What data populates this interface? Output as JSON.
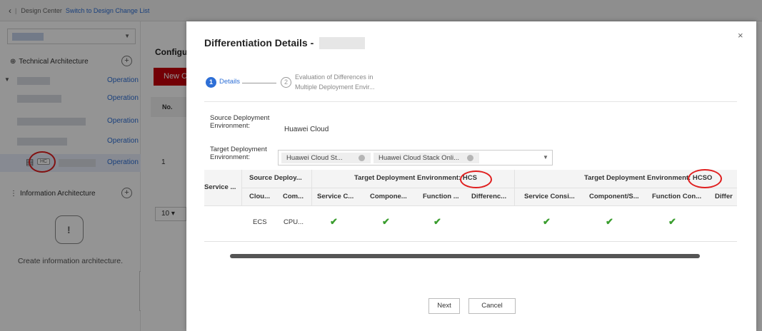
{
  "topbar": {
    "back_icon": "‹",
    "separator": "|",
    "title": "Design Center",
    "link": "Switch to Design Change List"
  },
  "sidebar": {
    "technical_architecture": "Technical Architecture",
    "information_architecture": "Information Architecture",
    "operation_label": "Operation",
    "hc_tag": "HC",
    "empty_text": "Create information architecture.",
    "collapse_icon": "‹"
  },
  "main": {
    "config_title": "Configu",
    "new_button": "New C",
    "table_header_no": "No.",
    "row_no": "1",
    "page_size": "10"
  },
  "modal": {
    "title": "Differentiation Details -",
    "close_icon": "×",
    "steps": [
      {
        "number": "1",
        "label": "Details"
      },
      {
        "number": "2",
        "label_line1": "Evaluation of Differences in",
        "label_line2": "Multiple Deployment Envir..."
      }
    ],
    "source_env_label_line1": "Source Deployment",
    "source_env_label_line2": "Environment:",
    "source_env_value": "Huawei Cloud",
    "target_env_label_line1": "Target Deployment",
    "target_env_label_line2": "Environment:",
    "target_chips": [
      "Huawei Cloud St...",
      "Huawei Cloud Stack Onli..."
    ],
    "table": {
      "col_service": "Service ...",
      "source_group": "Source Deploy...",
      "source_cols": [
        "Clou...",
        "Com..."
      ],
      "target_group_prefix": "Target Deployment Environment:",
      "hcs_label": "HCS",
      "hcso_label": "HCSO",
      "hcs_cols": [
        "Service C...",
        "Compone...",
        "Function ...",
        "Differenc..."
      ],
      "hcso_cols": [
        "Service Consi...",
        "Component/S...",
        "Function Con...",
        "Differ"
      ],
      "row": {
        "cloud": "ECS",
        "component": "CPU...",
        "check": "✔"
      }
    },
    "next_button": "Next",
    "cancel_button": "Cancel"
  },
  "colors": {
    "primary": "#2e6fd6",
    "brand_red": "#c7000b",
    "check_green": "#3a9d2e",
    "annotation_red": "#e02020"
  }
}
